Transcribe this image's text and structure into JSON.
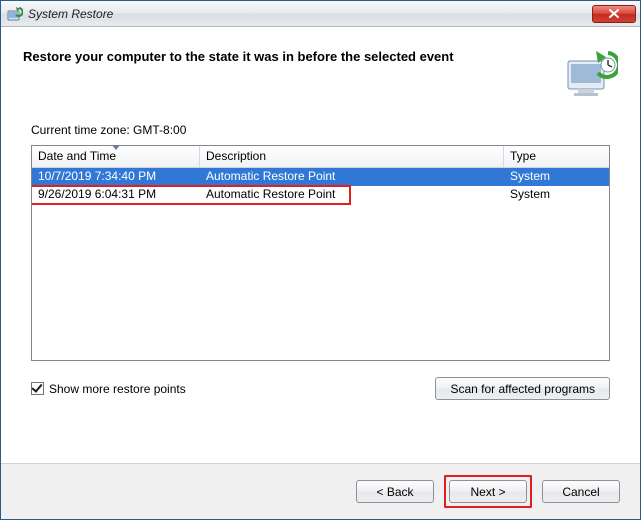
{
  "window": {
    "title": "System Restore"
  },
  "header": {
    "text": "Restore your computer to the state it was in before the selected event"
  },
  "timezone": {
    "label": "Current time zone: GMT-8:00"
  },
  "table": {
    "columns": {
      "date": "Date and Time",
      "desc": "Description",
      "type": "Type"
    },
    "rows": [
      {
        "date": "10/7/2019 7:34:40 PM",
        "desc": "Automatic Restore Point",
        "type": "System",
        "selected": true
      },
      {
        "date": "9/26/2019 6:04:31 PM",
        "desc": "Automatic Restore Point",
        "type": "System",
        "selected": false
      }
    ]
  },
  "controls": {
    "show_more_label": "Show more restore points",
    "show_more_checked": true,
    "scan_btn": "Scan for affected programs"
  },
  "footer": {
    "back": "< Back",
    "next": "Next >",
    "cancel": "Cancel"
  }
}
